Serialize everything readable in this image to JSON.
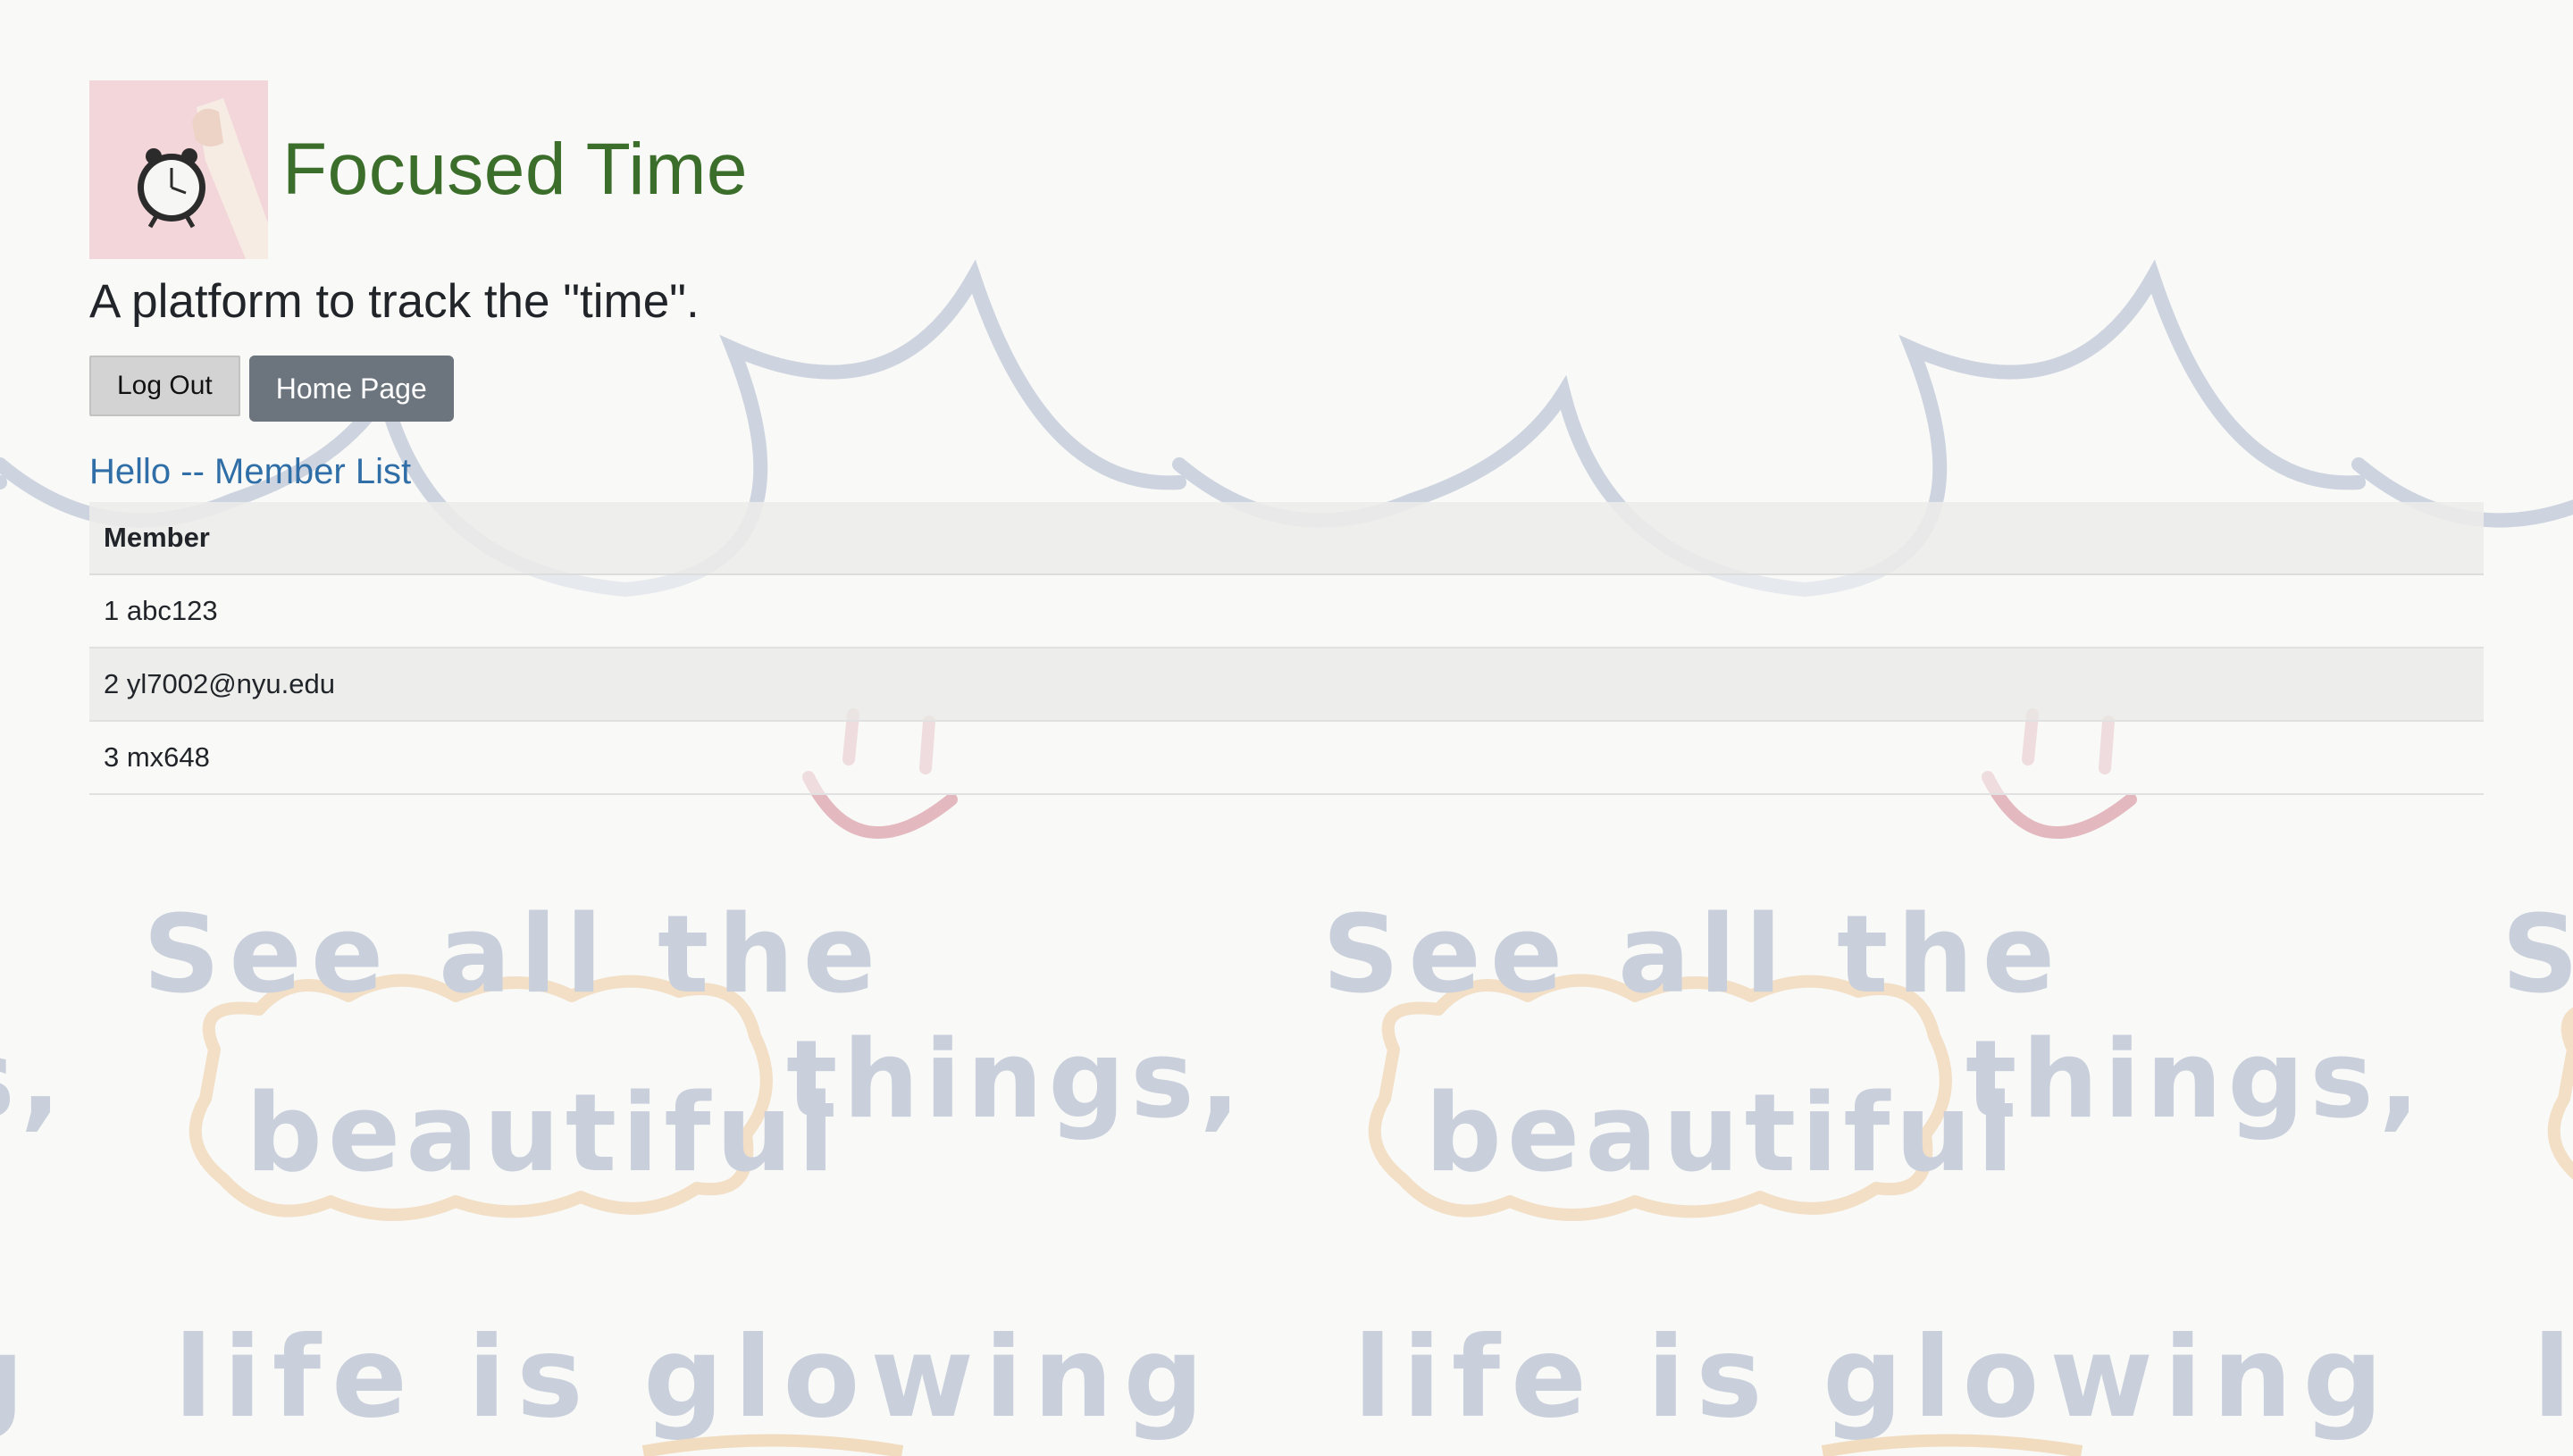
{
  "header": {
    "title": "Focused Time",
    "logo_icon": "alarm-clock-icon",
    "tagline": "A platform to track the \"time\"."
  },
  "buttons": {
    "logout_label": "Log Out",
    "home_label": "Home Page"
  },
  "members": {
    "heading": "Hello -- Member List",
    "column_header": "Member",
    "rows": [
      "1 abc123",
      "2 yl7002@nyu.edu",
      "3 mx648"
    ]
  },
  "background": {
    "line_1": "See all the",
    "highlight_word": "beautiful",
    "line_2_rest": "things,",
    "line_3": "life is glowing"
  },
  "colors": {
    "title": "#3b6e2b",
    "link": "#2f6ea6",
    "home_button": "#6c757d",
    "logout_button": "#d3d3d3"
  }
}
